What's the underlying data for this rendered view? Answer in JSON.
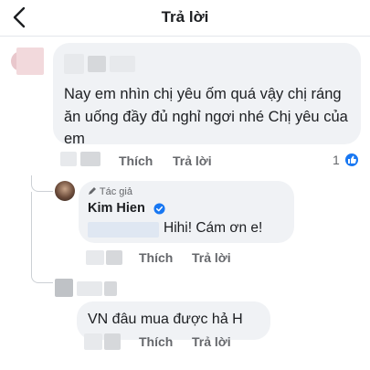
{
  "header": {
    "title": "Trả lời"
  },
  "comments": [
    {
      "text": "Nay em nhìn chị yêu ốm quá vậy chị ráng ăn uống đầy đủ nghỉ ngơi nhé Chị yêu của em",
      "actions": {
        "like": "Thích",
        "reply": "Trả lời"
      },
      "reaction_count": "1"
    },
    {
      "badge": "Tác giả",
      "author": "Kim Hien",
      "text": "Hihi! Cám ơn e!",
      "actions": {
        "like": "Thích",
        "reply": "Trả lời"
      }
    },
    {
      "text": "VN đâu mua được hả H",
      "actions": {
        "like": "Thích",
        "reply": "Trả lời"
      }
    }
  ],
  "colors": {
    "accent": "#1877f2",
    "bubble": "#f0f2f5",
    "muted": "#65676b"
  }
}
